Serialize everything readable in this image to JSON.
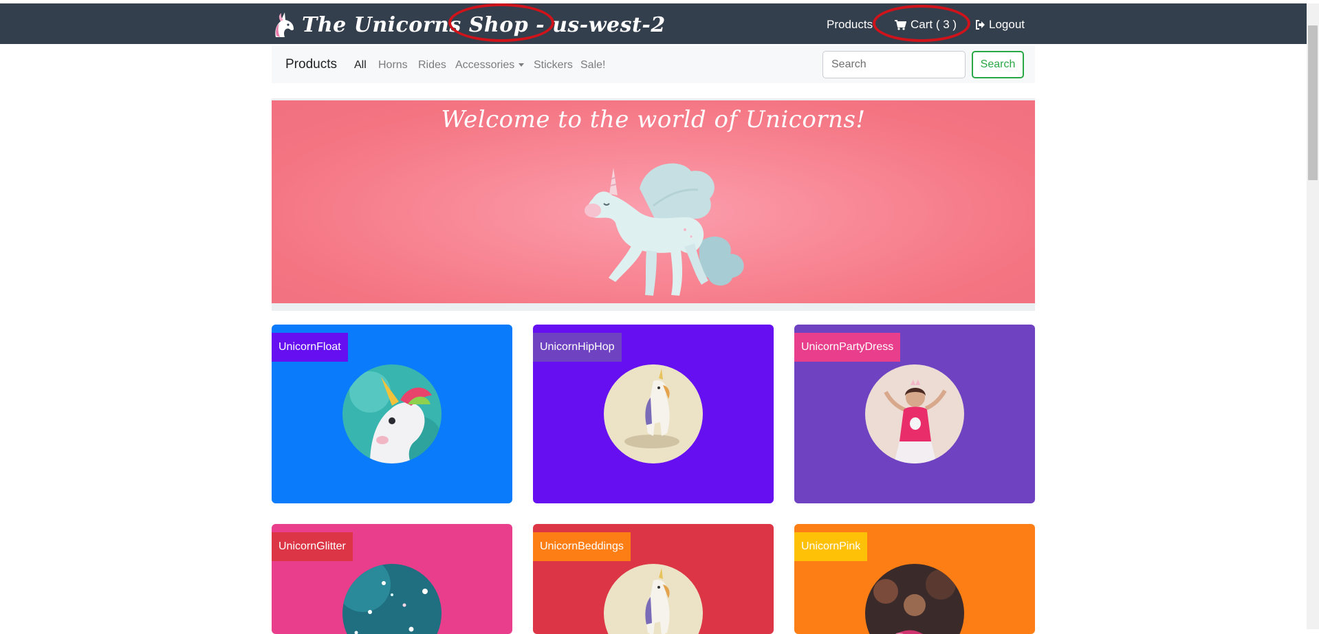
{
  "navbar": {
    "brand_title": "The Unicorns Shop - us-west-2",
    "products_label": "Products",
    "cart_label": "Cart ( 3 )",
    "logout_label": "Logout"
  },
  "subnav": {
    "title": "Products",
    "categories": {
      "all": "All",
      "horns": "Horns",
      "rides": "Rides",
      "accessories": "Accessories",
      "stickers": "Stickers",
      "sale": "Sale!"
    },
    "search_placeholder": "Search",
    "search_button": "Search"
  },
  "hero": {
    "title": "Welcome to the world of Unicorns!"
  },
  "products": [
    {
      "name": "UnicornFloat",
      "card_color": "#0a7bfb",
      "label_color": "#6610f2",
      "image": "inflatable-unicorn-image"
    },
    {
      "name": "UnicornHipHop",
      "card_color": "#6610f2",
      "label_color": "#6f42c1",
      "image": "unicorn-figurine-image"
    },
    {
      "name": "UnicornPartyDress",
      "card_color": "#6f42c1",
      "label_color": "#e83e8c",
      "image": "girl-party-dress-image"
    },
    {
      "name": "UnicornGlitter",
      "card_color": "#e83e8c",
      "label_color": "#dc3545",
      "image": "glitter-image"
    },
    {
      "name": "UnicornBeddings",
      "card_color": "#dc3545",
      "label_color": "#fd7e14",
      "image": "unicorn-figurine-image"
    },
    {
      "name": "UnicornPink",
      "card_color": "#fd7e14",
      "label_color": "#ffc107",
      "image": "pink-toys-image"
    }
  ],
  "colors": {
    "navbar": "#343f4d",
    "annotation_red": "#d0131a",
    "search_green": "#28a745",
    "hero_pink": "#f47482"
  }
}
